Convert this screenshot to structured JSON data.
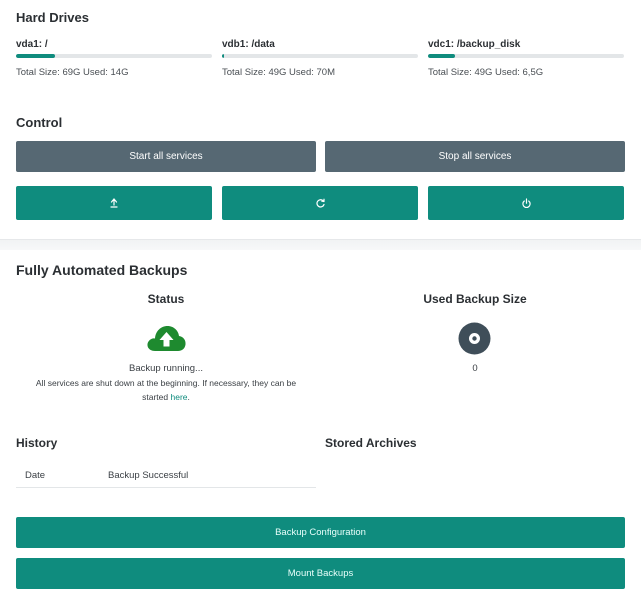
{
  "hard_drives": {
    "title": "Hard Drives",
    "drives": [
      {
        "name": "vda1: /",
        "info": "Total Size: 69G Used: 14G",
        "used_fraction": 0.2
      },
      {
        "name": "vdb1: /data",
        "info": "Total Size: 49G Used: 70M",
        "used_fraction": 0.01
      },
      {
        "name": "vdc1: /backup_disk",
        "info": "Total Size: 49G Used: 6,5G",
        "used_fraction": 0.14
      }
    ]
  },
  "control": {
    "title": "Control",
    "start_label": "Start all services",
    "stop_label": "Stop all services",
    "icons": [
      "upload-icon",
      "restart-icon",
      "power-icon"
    ]
  },
  "backups": {
    "title": "Fully Automated Backups",
    "status": {
      "title": "Status",
      "icon": "cloud-upload-icon",
      "running_text": "Backup running...",
      "note_line1": "All services are shut down at the beginning. If necessary, they can be",
      "note_line2_prefix": "started ",
      "note_link": "here",
      "note_line2_suffix": "."
    },
    "used_size": {
      "title": "Used Backup Size",
      "icon": "disk-icon",
      "value": "0"
    },
    "history": {
      "title": "History",
      "columns": [
        "Date",
        "Backup Successful"
      ]
    },
    "stored_archives": {
      "title": "Stored Archives"
    },
    "config_button": "Backup Configuration",
    "mount_button": "Mount Backups"
  },
  "colors": {
    "accent": "#0f8c7e",
    "control_gray": "#566873",
    "success_green": "#1e8a2f"
  }
}
